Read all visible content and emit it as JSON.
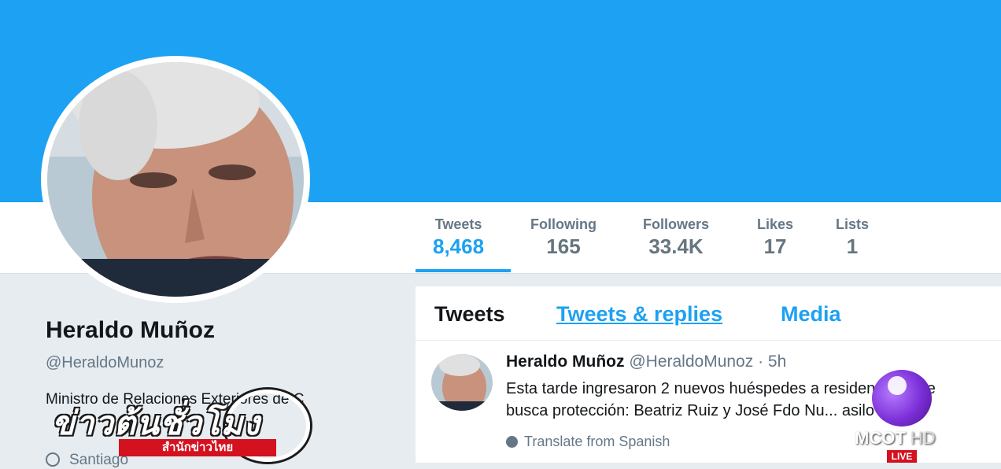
{
  "profile": {
    "name": "Heraldo Muñoz",
    "handle": "@HeraldoMunoz",
    "bio": "Ministro de Relaciones Exteriores de C",
    "location": "Santiago"
  },
  "stats": [
    {
      "label": "Tweets",
      "value": "8,468"
    },
    {
      "label": "Following",
      "value": "165"
    },
    {
      "label": "Followers",
      "value": "33.4K"
    },
    {
      "label": "Likes",
      "value": "17"
    },
    {
      "label": "Lists",
      "value": "1"
    }
  ],
  "timeline": {
    "tabs": [
      "Tweets",
      "Tweets & replies",
      "Media"
    ],
    "tweet": {
      "author": "Heraldo Muñoz",
      "handle": "@HeraldoMunoz",
      "time": "· 5h",
      "line1": "Esta tarde ingresaron 2 nuevos huéspedes a residencia Chile",
      "line2": "busca protección: Beatriz Ruiz y José Fdo Nu... asilo si lo p",
      "translate": "Translate from Spanish"
    }
  },
  "overlay": {
    "news_title": "ข่าวต้นชั่วโมง",
    "news_sub": "สำนักข่าวไทย",
    "channel": "MCOT",
    "channel_hd": "HD",
    "live": "LIVE"
  },
  "colors": {
    "accent": "#1da1f2",
    "banner": "#1da1f2",
    "text_primary": "#14171a",
    "text_secondary": "#657786"
  },
  "icons": {
    "location": "map-pin-icon",
    "translate": "globe-icon"
  }
}
